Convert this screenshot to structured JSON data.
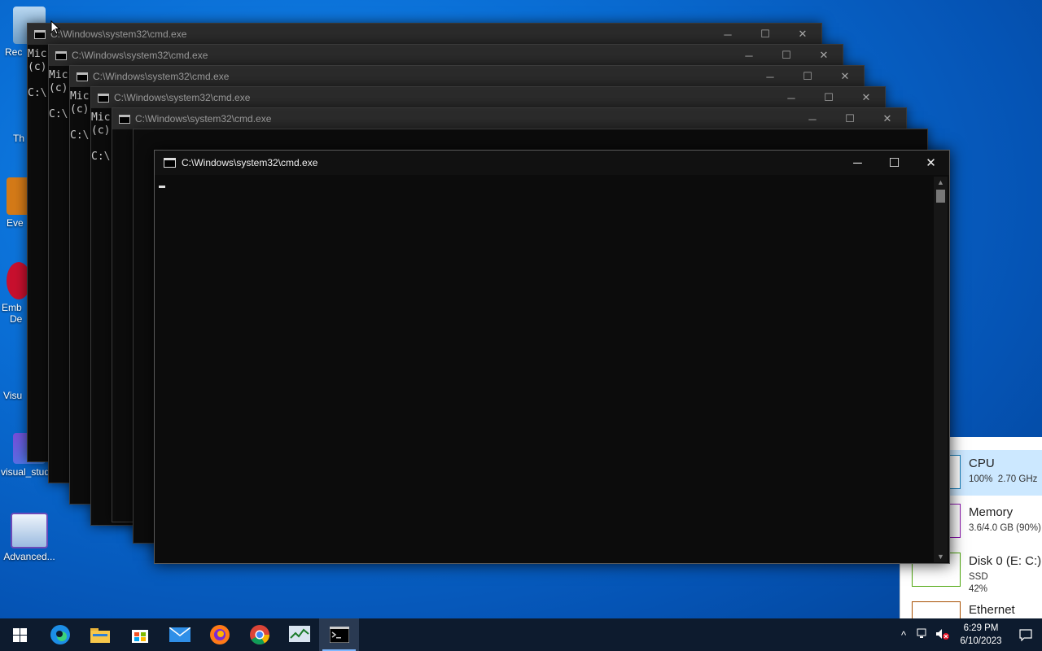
{
  "desktop": {
    "icons": [
      {
        "label": "Rec"
      },
      {
        "label": "Th"
      },
      {
        "label": "Eve"
      },
      {
        "label": "Emb",
        "label2": "De"
      },
      {
        "label": "Visu"
      },
      {
        "label": "visual_stud..."
      },
      {
        "label": "Advanced..."
      }
    ]
  },
  "task_manager": {
    "items": [
      {
        "title": "CPU",
        "detail": "100%  2.70 GHz",
        "color": "#117dbb"
      },
      {
        "title": "Memory",
        "detail": "3.6/4.0 GB (90%)",
        "color": "#8b12ae"
      },
      {
        "title": "Disk 0 (E: C:)",
        "detail": "SSD\n42%",
        "color": "#4da60c"
      },
      {
        "title": "Ethernet",
        "detail": "",
        "color": "#a74f01"
      }
    ]
  },
  "cmd_windows": {
    "title": "C:\\Windows\\system32\\cmd.exe",
    "lines_line1": "Mic",
    "lines_line2": "(c)",
    "lines_line3": "C:\\"
  },
  "front_window": {
    "title": "C:\\Windows\\system32\\cmd.exe"
  },
  "window_controls": {
    "minimize": "─",
    "maximize": "☐",
    "close": "✕"
  },
  "taskbar": {
    "apps": [
      "start",
      "edge",
      "file-explorer",
      "store",
      "mail",
      "firefox",
      "chrome",
      "task-manager",
      "cmd"
    ],
    "clock_time": "6:29 PM",
    "clock_date": "6/10/2023",
    "chevron": "^"
  }
}
